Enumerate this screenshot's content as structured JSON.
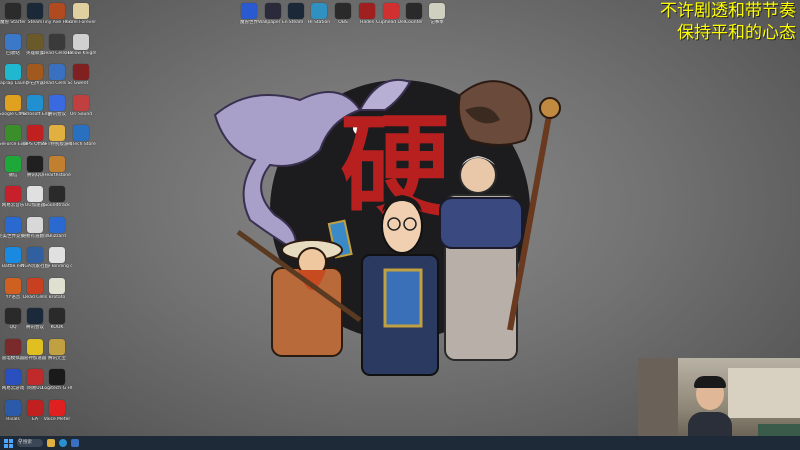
{
  "overlay": {
    "line1": "不许剧透和带节奏",
    "line2": "保持平和的心态"
  },
  "logo_text": "硬",
  "desktop_icons_left": [
    {
      "label": "魔兽 Starter",
      "icon": "starter-icon",
      "color": "#2b2b2b"
    },
    {
      "label": "回收站",
      "icon": "recycle-bin-icon",
      "color": "#3c78c8"
    },
    {
      "label": "TapTap Launcher",
      "icon": "taptap-icon",
      "color": "#1fb8d0"
    },
    {
      "label": "Google Chrome",
      "icon": "chrome-icon",
      "color": "#e0a020"
    },
    {
      "label": "GeForce Experience",
      "icon": "geforce-icon",
      "color": "#3a8f2a"
    },
    {
      "label": "微信",
      "icon": "wechat-icon",
      "color": "#1fa83a"
    },
    {
      "label": "网易云音乐",
      "icon": "netease-music-icon",
      "color": "#c8202a"
    },
    {
      "label": "完美世界竞技平台",
      "icon": "perfect-world-icon",
      "color": "#2a6ad0"
    },
    {
      "label": "Battle.net",
      "icon": "battlenet-icon",
      "color": "#1a8ae0"
    },
    {
      "label": "YY语音",
      "icon": "yy-icon",
      "color": "#d06020"
    },
    {
      "label": "QQ",
      "icon": "qq-icon",
      "color": "#2a2a2a"
    },
    {
      "label": "雷电模拟器",
      "icon": "ldplayer-icon",
      "color": "#7a2a2a"
    },
    {
      "label": "网易云游戏",
      "icon": "netease-cloud-icon",
      "color": "#2a50c0"
    },
    {
      "label": "Rivals",
      "icon": "rivals-icon",
      "color": "#2a5aa8"
    }
  ],
  "desktop_icons_col2": [
    {
      "label": "Steam",
      "icon": "steam-icon",
      "color": "#1b2838"
    },
    {
      "label": "英雄联盟",
      "icon": "lol-icon",
      "color": "#6a5a2a"
    },
    {
      "label": "炉石传说",
      "icon": "hearthstone-icon",
      "color": "#a05a20"
    },
    {
      "label": "Microsoft Edge",
      "icon": "edge-icon",
      "color": "#2090d0"
    },
    {
      "label": "WPS Office",
      "icon": "wps-icon",
      "color": "#c02020"
    },
    {
      "label": "腾讯QQ",
      "icon": "tencent-qq-icon",
      "color": "#202020"
    },
    {
      "label": "UU加速器",
      "icon": "uu-icon",
      "color": "#e0e0e0"
    },
    {
      "label": "网易有道翻译",
      "icon": "youdao-icon",
      "color": "#d8d8d8"
    },
    {
      "label": "NGA玩家社区",
      "icon": "nga-icon",
      "color": "#3060a0"
    },
    {
      "label": "Dead Cells",
      "icon": "deadcells-icon",
      "color": "#c84020"
    },
    {
      "label": "腾讯会议",
      "icon": "tencent-meeting-icon",
      "color": "#1a2a3a"
    },
    {
      "label": "雷神加速器",
      "icon": "leishen-icon",
      "color": "#e0c020"
    },
    {
      "label": "网易UU",
      "icon": "netease-uu-icon",
      "color": "#c02a2a"
    },
    {
      "label": "EA",
      "icon": "ea-icon",
      "color": "#c02020"
    }
  ],
  "desktop_icons_col3": [
    {
      "label": "Tiny Axe Heroes",
      "icon": "game-icon",
      "color": "#b04a20"
    },
    {
      "label": "Dead Cells Demake",
      "icon": "game-icon",
      "color": "#3a3a3a"
    },
    {
      "label": "Dead Cells Soundtrack",
      "icon": "music-icon",
      "color": "#3a70c0"
    },
    {
      "label": "腾讯会议",
      "icon": "meeting-icon",
      "color": "#3a6ae0"
    },
    {
      "label": "AFT特别版游戏",
      "icon": "folder-icon",
      "color": "#e0b040"
    },
    {
      "label": "Hearthstone",
      "icon": "hs-icon",
      "color": "#c08030"
    },
    {
      "label": "Soundtrack",
      "icon": "music-icon",
      "color": "#2a2a2a"
    },
    {
      "label": "Blizzard",
      "icon": "blizzard-icon",
      "color": "#2a6ad0"
    },
    {
      "label": "The Binding of Isaac",
      "icon": "isaac-icon",
      "color": "#e0e0e0"
    },
    {
      "label": "Brotato",
      "icon": "brotato-icon",
      "color": "#e0e0d0"
    },
    {
      "label": "KOOK",
      "icon": "kook-icon",
      "color": "#2a2a2a"
    },
    {
      "label": "腾讯元宝",
      "icon": "yuanbao-icon",
      "color": "#c0a040"
    },
    {
      "label": "Logitech G HUB",
      "icon": "ghub-icon",
      "color": "#1a1a1a"
    },
    {
      "label": "Voice Meter",
      "icon": "voicemeter-icon",
      "color": "#e02020"
    }
  ],
  "desktop_icons_col4": [
    {
      "label": "Corel Forever",
      "icon": "corel-icon",
      "color": "#e0d0a0"
    },
    {
      "label": "Hollow Knight",
      "icon": "hollow-knight-icon",
      "color": "#d0d0d0"
    },
    {
      "label": "Gwent",
      "icon": "gwent-icon",
      "color": "#802020"
    },
    {
      "label": "Ori Sound",
      "icon": "ori-icon",
      "color": "#c04040"
    },
    {
      "label": "HI Tech Store",
      "icon": "store-icon",
      "color": "#2a70c0"
    }
  ],
  "top_icons": [
    {
      "label": "魔兽世界",
      "icon": "wow-icon",
      "color": "#2a5ad0"
    },
    {
      "label": "Wallpaper Engine",
      "icon": "wallpaper-icon",
      "color": "#2a2a3a"
    },
    {
      "label": "Steam",
      "icon": "steam-icon",
      "color": "#1b2838"
    },
    {
      "label": "HI Station",
      "icon": "station-icon",
      "color": "#3090c0"
    },
    {
      "label": "OBS",
      "icon": "obs-icon",
      "color": "#2a2a2a"
    },
    {
      "label": "Hades",
      "icon": "hades-icon",
      "color": "#a02020"
    },
    {
      "label": "Cuphead Delicious",
      "icon": "cuphead-icon",
      "color": "#d03030"
    },
    {
      "label": "Counter",
      "icon": "counter-icon",
      "color": "#2a2a2a"
    },
    {
      "label": "记事本",
      "icon": "notepad-icon",
      "color": "#d0d0c0"
    }
  ],
  "taskbar": {
    "search_label": "搜索"
  }
}
